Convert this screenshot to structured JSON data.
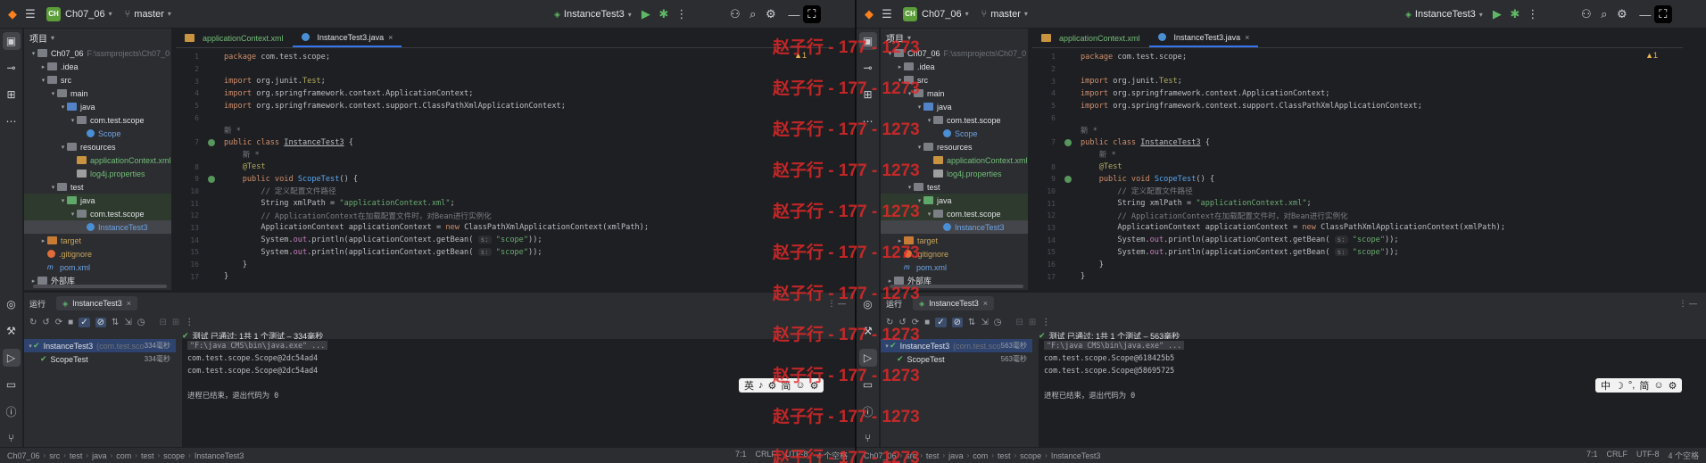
{
  "windows": [
    {
      "id": "left",
      "titlebar": {
        "project": "Ch07_06",
        "project_badge": "CH",
        "branch": "master",
        "run_config": "InstanceTest3"
      },
      "project_panel": {
        "title": "项目",
        "tree": [
          {
            "depth": 0,
            "label": "Ch07_06",
            "hint": "F:\\ssmprojects\\Ch07_0",
            "icon": "folder",
            "open": true
          },
          {
            "depth": 1,
            "label": ".idea",
            "icon": "folder",
            "open": false
          },
          {
            "depth": 1,
            "label": "src",
            "icon": "folder",
            "open": true
          },
          {
            "depth": 2,
            "label": "main",
            "icon": "folder",
            "open": true
          },
          {
            "depth": 3,
            "label": "java",
            "icon": "blue",
            "open": true
          },
          {
            "depth": 4,
            "label": "com.test.scope",
            "icon": "folder",
            "open": true
          },
          {
            "depth": 5,
            "label": "Scope",
            "icon": "cls",
            "style": "blue"
          },
          {
            "depth": 3,
            "label": "resources",
            "icon": "folder",
            "open": true
          },
          {
            "depth": 4,
            "label": "applicationContext.xml",
            "icon": "xml",
            "style": "green"
          },
          {
            "depth": 4,
            "label": "log4j.properties",
            "icon": "prop",
            "style": "green"
          },
          {
            "depth": 2,
            "label": "test",
            "icon": "folder",
            "open": true
          },
          {
            "depth": 3,
            "label": "java",
            "icon": "green",
            "open": true,
            "row": "green"
          },
          {
            "depth": 4,
            "label": "com.test.scope",
            "icon": "folder",
            "open": true,
            "row": "green"
          },
          {
            "depth": 5,
            "label": "InstanceTest3",
            "icon": "cls",
            "style": "blue",
            "row": "sel"
          },
          {
            "depth": 1,
            "label": "target",
            "icon": "orange",
            "open": false,
            "style": "orange"
          },
          {
            "depth": 1,
            "label": ".gitignore",
            "icon": "git",
            "style": "orange"
          },
          {
            "depth": 1,
            "label": "pom.xml",
            "icon": "m",
            "style": "blue"
          },
          {
            "depth": 0,
            "label": "外部库",
            "icon": "folder",
            "open": false
          }
        ]
      },
      "editor": {
        "tabs": [
          {
            "label": "applicationContext.xml",
            "active": false
          },
          {
            "label": "InstanceTest3.java",
            "active": true
          }
        ],
        "inspection": "▲1"
      },
      "run_panel": {
        "title": "运行",
        "tab": "InstanceTest3",
        "tree": [
          {
            "label": "InstanceTest3",
            "extra": "(com.test.sco",
            "duration": "334毫秒",
            "selected": true
          },
          {
            "label": "ScopeTest",
            "extra": "",
            "duration": "334毫秒",
            "selected": false
          }
        ],
        "status": "测试 已通过: 1共 1 个测试 – 334毫秒",
        "console": [
          {
            "text": "\"F:\\java CMS\\bin\\java.exe\" ...",
            "cmd": true
          },
          {
            "text": "com.test.scope.Scope@2dc54ad4",
            "cmd": false
          },
          {
            "text": "com.test.scope.Scope@2dc54ad4",
            "cmd": false
          },
          {
            "text": "",
            "cmd": false
          },
          {
            "text": "进程已结束，退出代码为 0",
            "cmd": false
          }
        ]
      },
      "ime": [
        "英",
        "♪",
        "⚙",
        "简",
        "☺",
        "⚙"
      ],
      "statusbar": {
        "crumbs": [
          "Ch07_06",
          "src",
          "test",
          "java",
          "com",
          "test",
          "scope",
          "InstanceTest3"
        ],
        "right": [
          "7:1",
          "CRLF",
          "UTF-8",
          "4 个空格"
        ]
      }
    },
    {
      "id": "right",
      "titlebar": {
        "project": "Ch07_06",
        "project_badge": "CH",
        "branch": "master",
        "run_config": "InstanceTest3"
      },
      "project_panel": {
        "title": "项目",
        "tree": [
          {
            "depth": 0,
            "label": "Ch07_06",
            "hint": "F:\\ssmprojects\\Ch07_0",
            "icon": "folder",
            "open": true
          },
          {
            "depth": 1,
            "label": ".idea",
            "icon": "folder",
            "open": false
          },
          {
            "depth": 1,
            "label": "src",
            "icon": "folder",
            "open": true
          },
          {
            "depth": 2,
            "label": "main",
            "icon": "folder",
            "open": true
          },
          {
            "depth": 3,
            "label": "java",
            "icon": "blue",
            "open": true
          },
          {
            "depth": 4,
            "label": "com.test.scope",
            "icon": "folder",
            "open": true
          },
          {
            "depth": 5,
            "label": "Scope",
            "icon": "cls",
            "style": "blue"
          },
          {
            "depth": 3,
            "label": "resources",
            "icon": "folder",
            "open": true
          },
          {
            "depth": 4,
            "label": "applicationContext.xml",
            "icon": "xml",
            "style": "green"
          },
          {
            "depth": 4,
            "label": "log4j.properties",
            "icon": "prop",
            "style": "green"
          },
          {
            "depth": 2,
            "label": "test",
            "icon": "folder",
            "open": true
          },
          {
            "depth": 3,
            "label": "java",
            "icon": "green",
            "open": true,
            "row": "green"
          },
          {
            "depth": 4,
            "label": "com.test.scope",
            "icon": "folder",
            "open": true,
            "row": "green"
          },
          {
            "depth": 5,
            "label": "InstanceTest3",
            "icon": "cls",
            "style": "blue",
            "row": "sel"
          },
          {
            "depth": 1,
            "label": "target",
            "icon": "orange",
            "open": false,
            "style": "orange"
          },
          {
            "depth": 1,
            "label": ".gitignore",
            "icon": "git",
            "style": "orange"
          },
          {
            "depth": 1,
            "label": "pom.xml",
            "icon": "m",
            "style": "blue"
          },
          {
            "depth": 0,
            "label": "外部库",
            "icon": "folder",
            "open": false
          }
        ]
      },
      "editor": {
        "tabs": [
          {
            "label": "applicationContext.xml",
            "active": false
          },
          {
            "label": "InstanceTest3.java",
            "active": true
          }
        ],
        "inspection": "▲1"
      },
      "run_panel": {
        "title": "运行",
        "tab": "InstanceTest3",
        "tree": [
          {
            "label": "InstanceTest3",
            "extra": "(com.test.sco",
            "duration": "563毫秒",
            "selected": true
          },
          {
            "label": "ScopeTest",
            "extra": "",
            "duration": "563毫秒",
            "selected": false
          }
        ],
        "status": "测试 已通过: 1共 1 个测试 – 563毫秒",
        "console": [
          {
            "text": "\"F:\\java CMS\\bin\\java.exe\" ...",
            "cmd": true
          },
          {
            "text": "com.test.scope.Scope@618425b5",
            "cmd": false
          },
          {
            "text": "com.test.scope.Scope@58695725",
            "cmd": false
          },
          {
            "text": "",
            "cmd": false
          },
          {
            "text": "进程已结束，退出代码为 0",
            "cmd": false
          }
        ]
      },
      "ime": [
        "中",
        "☽",
        "°,",
        "简",
        "☺",
        "⚙"
      ],
      "statusbar": {
        "crumbs": [
          "Ch07_06",
          "src",
          "test",
          "java",
          "com",
          "test",
          "scope",
          "InstanceTest3"
        ],
        "right": [
          "7:1",
          "CRLF",
          "UTF-8",
          "4 个空格"
        ]
      }
    }
  ],
  "code": [
    {
      "n": "1",
      "html": "<span class='kw'>package</span> com.test.scope;"
    },
    {
      "n": "2",
      "html": ""
    },
    {
      "n": "3",
      "html": "<span class='kw'>import</span> org.junit.<span class='ann'>Test</span>;"
    },
    {
      "n": "4",
      "html": "<span class='kw'>import</span> org.springframework.context.ApplicationContext;"
    },
    {
      "n": "5",
      "html": "<span class='kw'>import</span> org.springframework.context.support.ClassPathXmlApplicationContext;"
    },
    {
      "n": "6",
      "html": ""
    },
    {
      "n": "",
      "html": "<span class='cm'>新 *</span>"
    },
    {
      "n": "7",
      "html": "<span class='kw'>public class</span> <span class='cls-u'>InstanceTest3</span> {",
      "run": true
    },
    {
      "n": "",
      "html": "    <span class='cm'>新 *</span>"
    },
    {
      "n": "8",
      "html": "    <span class='ann'>@Test</span>"
    },
    {
      "n": "9",
      "html": "    <span class='kw'>public void</span> <span class='fn'>ScopeTest</span>() {",
      "run": true
    },
    {
      "n": "10",
      "html": "        <span class='cm'>// 定义配置文件路径</span>"
    },
    {
      "n": "11",
      "html": "        String xmlPath = <span class='str'>\"applicationContext.xml\"</span>;"
    },
    {
      "n": "12",
      "html": "        <span class='cm'>// ApplicationContext在加载配置文件时，对Bean进行实例化</span>"
    },
    {
      "n": "13",
      "html": "        ApplicationContext applicationContext = <span class='kw'>new</span> ClassPathXmlApplicationContext(xmlPath);"
    },
    {
      "n": "14",
      "html": "        System.<span class='fld'>out</span>.println(applicationContext.getBean( <span class='hint'>s:</span> <span class='str'>\"scope\"</span>));"
    },
    {
      "n": "15",
      "html": "        System.<span class='fld'>out</span>.println(applicationContext.getBean( <span class='hint'>s:</span> <span class='str'>\"scope\"</span>));"
    },
    {
      "n": "16",
      "html": "    }"
    },
    {
      "n": "17",
      "html": "}"
    }
  ],
  "watermark": "赵子行 - 177 - 1273"
}
